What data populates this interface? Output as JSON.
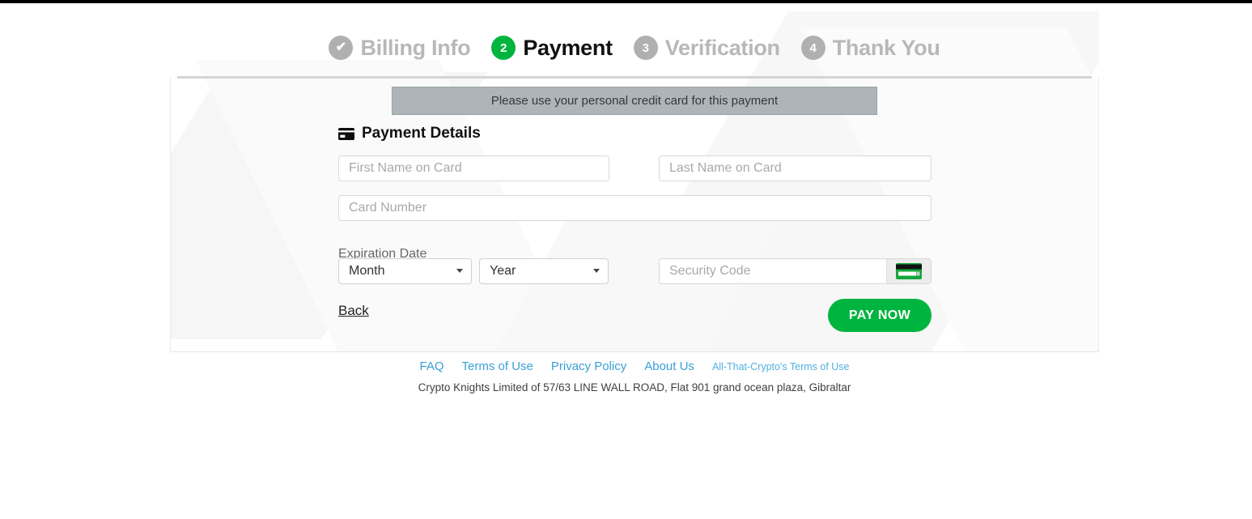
{
  "stepper": {
    "steps": [
      {
        "badge": "✔",
        "label": "Billing Info",
        "state": "done"
      },
      {
        "badge": "2",
        "label": "Payment",
        "state": "active"
      },
      {
        "badge": "3",
        "label": "Verification",
        "state": "todo"
      },
      {
        "badge": "4",
        "label": "Thank You",
        "state": "todo"
      }
    ]
  },
  "notice": {
    "text": "Please use your personal credit card for this payment"
  },
  "details": {
    "heading": "Payment Details",
    "card_icon": "credit-card-icon",
    "first_name_placeholder": "First Name on Card",
    "first_name_value": "",
    "last_name_placeholder": "Last Name on Card",
    "last_name_value": "",
    "card_number_placeholder": "Card Number",
    "card_number_value": "",
    "expiration_label": "Expiration Date",
    "month_selected": "Month",
    "year_selected": "Year",
    "security_code_placeholder": "Security Code",
    "security_code_value": "",
    "cvv_icon": "credit-card-back-icon"
  },
  "actions": {
    "back_label": "Back",
    "pay_label": "PAY NOW"
  },
  "footer": {
    "links": [
      "FAQ",
      "Terms of Use",
      "Privacy Policy",
      "About Us"
    ],
    "small_link": "All-That-Crypto's Terms of Use",
    "legal": "Crypto Knights Limited of 57/63 LINE WALL ROAD, Flat 901 grand ocean plaza, Gibraltar"
  },
  "colors": {
    "accent_green": "#00b53f",
    "muted_gray": "#b8b8b8",
    "badge_gray": "#b0b0b0",
    "link_blue": "#3a9fd8",
    "notice_bg": "#adb5b8"
  }
}
